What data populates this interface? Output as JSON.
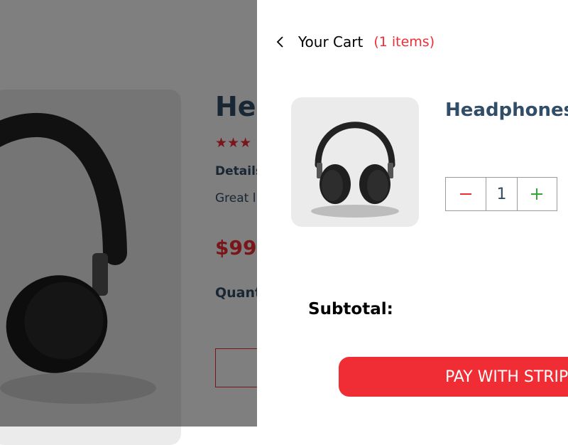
{
  "product_page": {
    "title": "Headphones",
    "rating_stars": "★★★",
    "details_heading": "Details",
    "details_text": "Great l",
    "price": "$99",
    "quantity_label": "Quant"
  },
  "cart": {
    "back_icon": "chevron-left-icon",
    "title": "Your Cart",
    "count_label": "(1 items)",
    "items": [
      {
        "name": "Headphones",
        "quantity": "1"
      }
    ],
    "subtotal_label": "Subtotal:",
    "pay_button_label": "PAY WITH STRIPE"
  },
  "colors": {
    "accent": "#f02d34",
    "heading": "#324d67",
    "plus": "#31a831",
    "image_bg": "#ebebeb"
  }
}
